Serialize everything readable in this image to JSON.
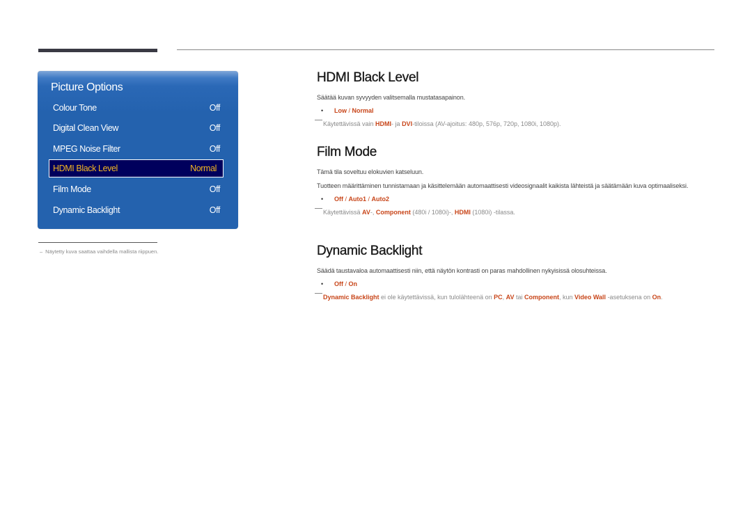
{
  "panel": {
    "title": "Picture Options",
    "items": [
      {
        "label": "Colour Tone",
        "value": "Off"
      },
      {
        "label": "Digital Clean View",
        "value": "Off"
      },
      {
        "label": "MPEG Noise Filter",
        "value": "Off"
      },
      {
        "label": "HDMI Black Level",
        "value": "Normal",
        "selected": true
      },
      {
        "label": "Film Mode",
        "value": "Off"
      },
      {
        "label": "Dynamic Backlight",
        "value": "Off"
      }
    ]
  },
  "footnote": {
    "dash": "–",
    "text": "Näytetty kuva saattaa vaihdella mallista riippuen."
  },
  "colors": {
    "panel_blue": "#2462ae",
    "selected_bg": "#00005c",
    "selected_text": "#f3b623",
    "accent_orange": "#c8461a"
  },
  "sections": {
    "hdmi": {
      "title": "HDMI Black Level",
      "description": "Säätää kuvan syvyyden valitsemalla mustatasapainon.",
      "options": [
        "Low",
        "Normal"
      ],
      "separator": " / ",
      "note": {
        "t1": "Käytettävissä vain ",
        "h1": "HDMI",
        "t2": "- ja ",
        "h2": "DVI",
        "t3": "-tiloissa (AV-ajoitus: 480p, 576p, 720p, 1080i, 1080p)."
      }
    },
    "film": {
      "title": "Film Mode",
      "description1": "Tämä tila soveltuu elokuvien katseluun.",
      "description2": "Tuotteen määrittäminen tunnistamaan ja käsittelemään automaattisesti videosignaalit kaikista lähteistä ja säätämään kuva optimaaliseksi.",
      "options": [
        "Off",
        "Auto1",
        "Auto2"
      ],
      "separator": " / ",
      "note": {
        "t1": "Käytettävissä ",
        "h1": "AV",
        "t2": "-, ",
        "h2": "Component",
        "t3": " (480i / 1080i)-, ",
        "h3": "HDMI",
        "t4": " (1080i) -tilassa."
      }
    },
    "backlight": {
      "title": "Dynamic Backlight",
      "description": "Säädä taustavaloa automaattisesti niin, että näytön kontrasti on paras mahdollinen nykyisissä olosuhteissa.",
      "options": [
        "Off",
        "On"
      ],
      "separator": " / ",
      "note": {
        "h1": "Dynamic Backlight",
        "t1": " ei ole käytettävissä, kun tulolähteenä on ",
        "h2": "PC",
        "t2": ", ",
        "h3": "AV",
        "t3": " tai ",
        "h4": "Component",
        "t4": ", kun ",
        "h5": "Video Wall",
        "t5": " -asetuksena on ",
        "h6": "On",
        "t6": "."
      }
    }
  },
  "bullet_glyph": "•"
}
